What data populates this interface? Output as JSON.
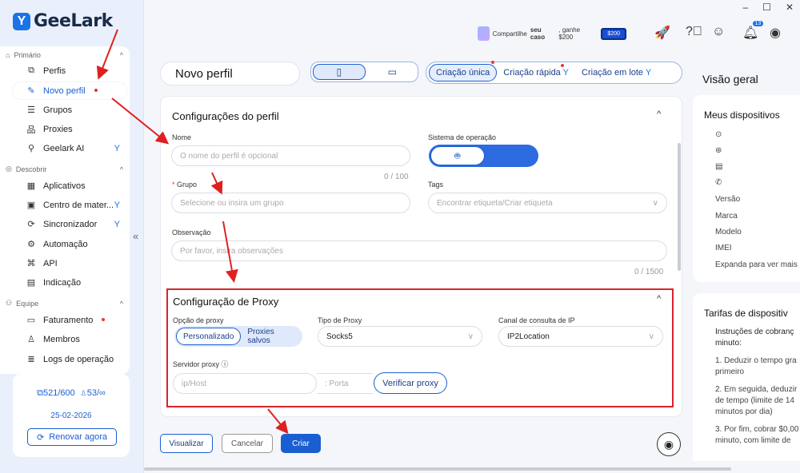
{
  "app": {
    "logo_text": "GeeLark",
    "logo_mark": "Y"
  },
  "sidebar": {
    "sections": {
      "primary": "Primário",
      "discover": "Descobrir",
      "team": "Equipe"
    },
    "items": [
      {
        "label": "Perfis",
        "icon": "profile-icon"
      },
      {
        "label": "Novo perfil",
        "icon": "edit-icon"
      },
      {
        "label": "Grupos",
        "icon": "list-icon"
      },
      {
        "label": "Proxies",
        "icon": "network-icon"
      },
      {
        "label": "Geelark AI",
        "icon": "ai-icon"
      },
      {
        "label": "Aplicativos",
        "icon": "apps-icon"
      },
      {
        "label": "Centro de mater...",
        "icon": "materials-icon"
      },
      {
        "label": "Sincronizador",
        "icon": "sync-icon"
      },
      {
        "label": "Automação",
        "icon": "robot-icon"
      },
      {
        "label": "API",
        "icon": "api-icon"
      },
      {
        "label": "Indicação",
        "icon": "gift-icon"
      },
      {
        "label": "Faturamento",
        "icon": "billing-icon"
      },
      {
        "label": "Membros",
        "icon": "members-icon"
      },
      {
        "label": "Logs de operação",
        "icon": "logs-icon"
      }
    ],
    "stats": {
      "profiles": "521/600",
      "members": "53/∞",
      "date": "25-02-2026",
      "renew_label": "Renovar agora"
    }
  },
  "topbar": {
    "banner_text": "Compartilhe",
    "banner_bold": "seu caso",
    "banner_suffix": ", ganhe $200",
    "banner_amount": "$200",
    "notification_count": "13"
  },
  "page": {
    "title": "Novo perfil",
    "modes": [
      "Criação única",
      "Criação rápida",
      "Criação em lote"
    ]
  },
  "profile_config": {
    "section_title": "Configurações do perfil",
    "name_label": "Nome",
    "name_placeholder": "O nome do perfil é opcional",
    "name_count": "0 / 100",
    "os_label": "Sistema de operação",
    "group_label": "Grupo",
    "group_placeholder": "Selecione ou insira um grupo",
    "tags_label": "Tags",
    "tags_placeholder": "Encontrar etiqueta/Criar etiqueta",
    "note_label": "Observação",
    "note_placeholder": "Por favor, insira observações",
    "note_count": "0 / 1500"
  },
  "proxy_config": {
    "section_title": "Configuração de Proxy",
    "option_label": "Opção de proxy",
    "option_custom": "Personalizado",
    "option_saved": "Proxies salvos",
    "type_label": "Tipo de Proxy",
    "type_value": "Socks5",
    "channel_label": "Canal de consulta de IP",
    "channel_value": "IP2Location",
    "server_label": "Servidor proxy",
    "host_placeholder": "ip/Host",
    "port_placeholder": ": Porta",
    "verify_label": "Verificar proxy"
  },
  "footer": {
    "preview": "Visualizar",
    "cancel": "Cancelar",
    "create": "Criar"
  },
  "overview": {
    "title": "Visão geral",
    "devices_title": "Meus dispositivos",
    "fields": [
      "Versão",
      "Marca",
      "Modelo",
      "IMEI"
    ],
    "expand": "Expanda para ver mais",
    "rates_title": "Tarifas de dispositiv",
    "rates_lines": [
      "Instruções de cobranç",
      "minuto:",
      "1. Deduzir o tempo gra",
      "primeiro",
      "2. Em seguida, deduzir",
      "de tempo (limite de 14",
      "minutos por dia)",
      "3. Por fim, cobrar $0,00",
      "minuto, com limite de"
    ]
  }
}
